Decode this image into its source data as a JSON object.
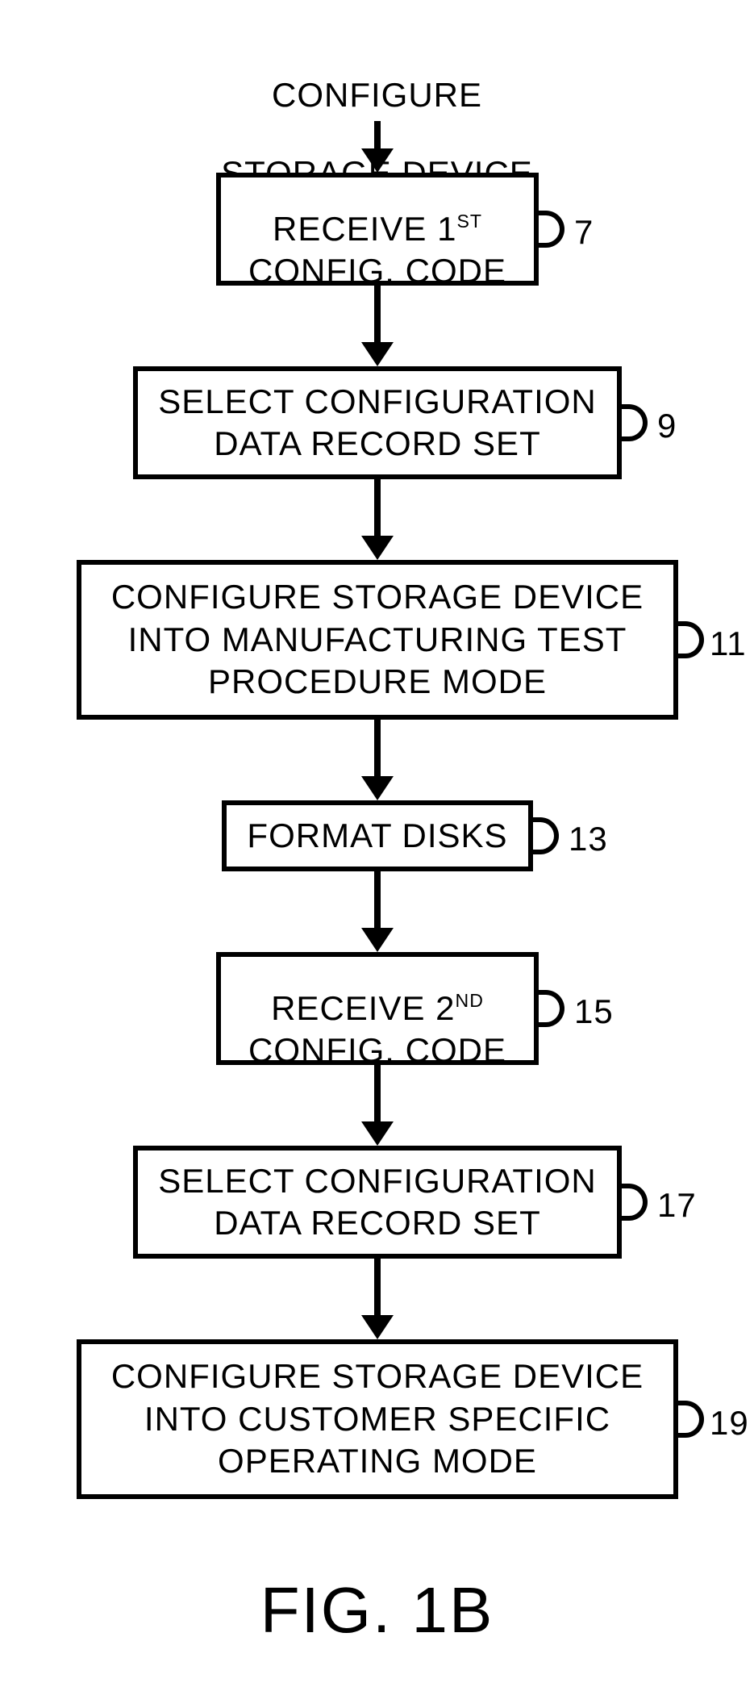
{
  "chart_data": {
    "type": "flowchart",
    "title": "CONFIGURE STORAGE DEVICE",
    "figure_label": "FIG. 1B",
    "steps": [
      {
        "ref": "7",
        "label": "RECEIVE 1ST CONFIG. CODE"
      },
      {
        "ref": "9",
        "label": "SELECT CONFIGURATION DATA RECORD SET"
      },
      {
        "ref": "11",
        "label": "CONFIGURE STORAGE DEVICE INTO MANUFACTURING TEST PROCEDURE MODE"
      },
      {
        "ref": "13",
        "label": "FORMAT DISKS"
      },
      {
        "ref": "15",
        "label": "RECEIVE 2ND CONFIG. CODE"
      },
      {
        "ref": "17",
        "label": "SELECT CONFIGURATION DATA RECORD SET"
      },
      {
        "ref": "19",
        "label": "CONFIGURE STORAGE DEVICE INTO CUSTOMER SPECIFIC OPERATING MODE"
      }
    ],
    "edges": [
      [
        "title",
        "7"
      ],
      [
        "7",
        "9"
      ],
      [
        "9",
        "11"
      ],
      [
        "11",
        "13"
      ],
      [
        "13",
        "15"
      ],
      [
        "15",
        "17"
      ],
      [
        "17",
        "19"
      ]
    ]
  },
  "title_line1": "CONFIGURE",
  "title_line2": "STORAGE DEVICE",
  "step7_pre": "RECEIVE 1",
  "step7_ord": "ST",
  "step7_post": "\nCONFIG. CODE",
  "ref7": "7",
  "step9": "SELECT CONFIGURATION\nDATA RECORD SET",
  "ref9": "9",
  "step11": "CONFIGURE STORAGE DEVICE\nINTO MANUFACTURING TEST\nPROCEDURE MODE",
  "ref11": "11",
  "step13": "FORMAT DISKS",
  "ref13": "13",
  "step15_pre": "RECEIVE 2",
  "step15_ord": "ND",
  "step15_post": "\nCONFIG. CODE",
  "ref15": "15",
  "step17": "SELECT CONFIGURATION\nDATA RECORD SET",
  "ref17": "17",
  "step19": "CONFIGURE STORAGE DEVICE\nINTO CUSTOMER SPECIFIC\nOPERATING MODE",
  "ref19": "19",
  "figure": "FIG. 1B"
}
